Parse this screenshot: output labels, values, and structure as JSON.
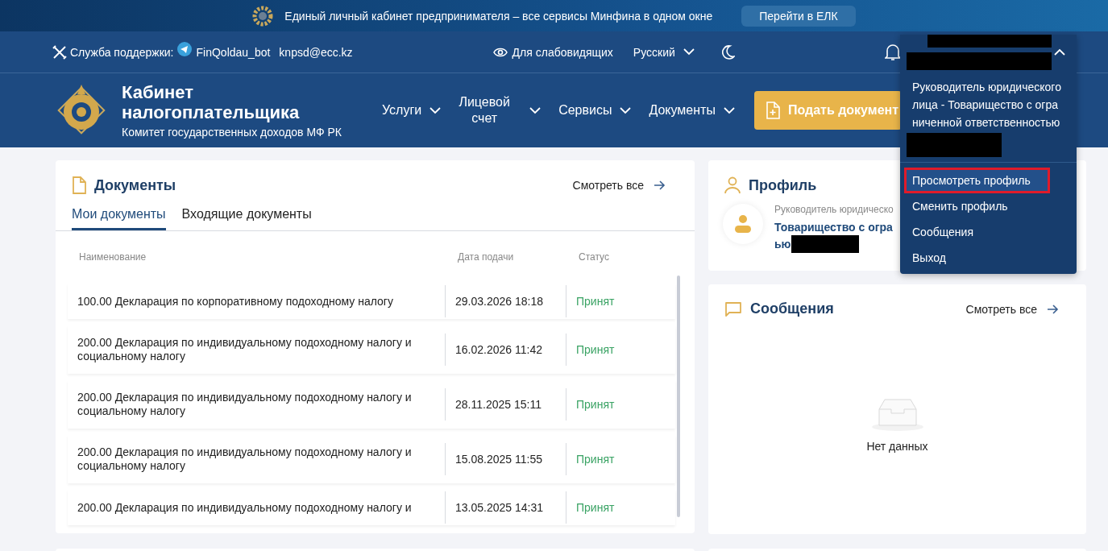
{
  "banner": {
    "text": "Единый личный кабинет предпринимателя – все сервисы Минфина в одном окне",
    "button": "Перейти в ЕЛК"
  },
  "utility_bar": {
    "support_label": "Служба поддержки:",
    "telegram": "FinQoldau_bot",
    "email": "knpsd@ecc.kz",
    "accessibility": "Для слабовидящих",
    "language": "Русский"
  },
  "header": {
    "title": "Кабинет налогоплательщика",
    "subtitle": "Комитет государственных доходов МФ РК",
    "nav": [
      {
        "label": "Услуги"
      },
      {
        "label": "Лицевой счет"
      },
      {
        "label": "Сервисы"
      },
      {
        "label": "Документы"
      }
    ],
    "action_button": "Подать документ"
  },
  "user_menu": {
    "expanded": true,
    "role": "Руководитель юридического лица - Товарищество с огра ниченной ответственностью",
    "items": [
      {
        "label": "Просмотреть профиль",
        "selected": true,
        "highlighted": true
      },
      {
        "label": "Сменить профиль",
        "selected": false,
        "highlighted": false
      },
      {
        "label": "Сообщения",
        "selected": false,
        "highlighted": false
      },
      {
        "label": "Выход",
        "selected": false,
        "highlighted": false
      }
    ]
  },
  "documents": {
    "title": "Документы",
    "see_all": "Смотреть все",
    "tabs": [
      {
        "label": "Мои документы",
        "selected": true
      },
      {
        "label": "Входящие документы",
        "selected": false
      }
    ],
    "columns": [
      "Наименование",
      "Дата подачи",
      "Статус"
    ],
    "rows": [
      {
        "name": "100.00 Декларация по корпоративному подоходному налогу",
        "date": "29.03.2026 18:18",
        "status": "Принят"
      },
      {
        "name": "200.00 Декларация по индивидуальному подоходному налогу и социальному налогу",
        "date": "16.02.2026 11:42",
        "status": "Принят"
      },
      {
        "name": "200.00 Декларация по индивидуальному подоходному налогу и социальному налогу",
        "date": "28.11.2025 15:11",
        "status": "Принят"
      },
      {
        "name": "200.00 Декларация по индивидуальному подоходному налогу и социальному налогу",
        "date": "15.08.2025 11:55",
        "status": "Принят"
      },
      {
        "name": "200.00 Декларация по индивидуальному подоходному налогу и",
        "date": "13.05.2025 14:31",
        "status": "Принят"
      }
    ]
  },
  "profile": {
    "title": "Профиль",
    "role": "Руководитель юридическо",
    "name_line1": "Товарищество с огра",
    "name_line2": "ью"
  },
  "messages": {
    "title": "Сообщения",
    "see_all": "Смотреть все",
    "empty": "Нет данных"
  }
}
